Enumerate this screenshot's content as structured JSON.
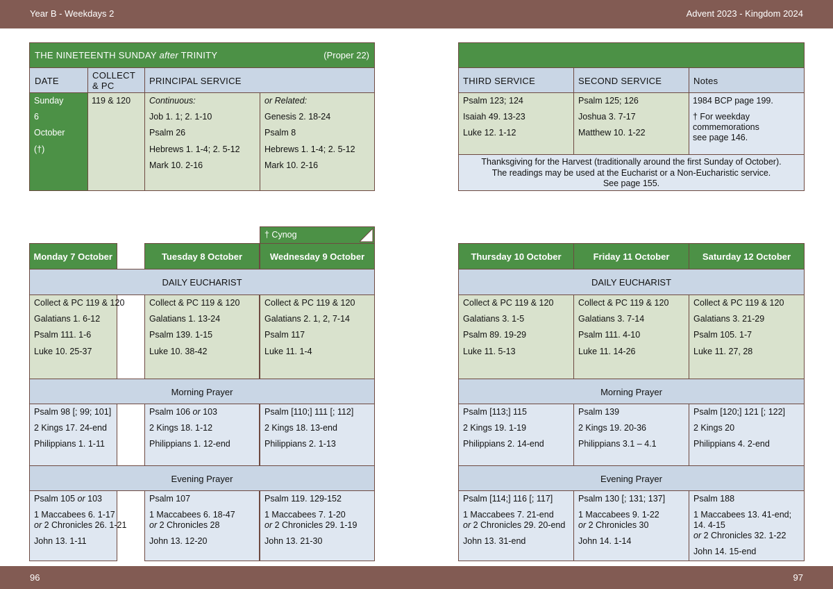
{
  "header": {
    "left": "Year B - Weekdays 2",
    "right": "Advent  2023 - Kingdom 2024"
  },
  "footer": {
    "left": "96",
    "right": "97"
  },
  "sunday": {
    "title_pre": "THE NINETEENTH SUNDAY ",
    "title_after": "after",
    "title_post": " TRINITY",
    "proper": "(Proper 22)",
    "col_date": "DATE",
    "col_collect_1": "COLLECT",
    "col_collect_2": "& PC",
    "col_principal": "PRINCIPAL SERVICE",
    "date_lines": [
      "Sunday",
      "6",
      "October",
      "(†)"
    ],
    "collect": "119 & 120",
    "continuous": [
      "Continuous:",
      "Job 1. 1;  2. 1-10",
      "Psalm 26",
      "Hebrews 1. 1-4; 2. 5-12",
      "Mark 10. 2-16"
    ],
    "related": [
      "or Related:",
      "Genesis 2. 18-24",
      "Psalm 8",
      "Hebrews 1. 1-4; 2. 5-12",
      "Mark 10. 2-16"
    ]
  },
  "right_top": {
    "col_third": "THIRD SERVICE",
    "col_second": "SECOND SERVICE",
    "col_notes": "Notes",
    "third": [
      "Psalm 123; 124",
      "Isaiah 49. 13-23",
      "Luke 12. 1-12"
    ],
    "second": [
      "Psalm 125; 126",
      "Joshua 3. 7-17",
      "Matthew 10. 1-22"
    ],
    "notes_1": "1984 BCP page 199.",
    "notes_2": [
      "† For weekday",
      "commemorations",
      "see page 146."
    ],
    "harvest": [
      "Thanksgiving for the Harvest (traditionally around the first Sunday of October).",
      "The readings may be used at the Eucharist or a Non-Eucharistic service.",
      "See page 155."
    ]
  },
  "cynog": "† Cynog",
  "sections": {
    "eucharist": "DAILY EUCHARIST",
    "morning": "Morning Prayer",
    "evening": "Evening Prayer"
  },
  "days": [
    {
      "name": "Monday 7 October",
      "eucharist": [
        "Collect & PC 119 & 120",
        "Galatians 1. 6-12",
        "Psalm 111. 1-6",
        "Luke 10. 25-37"
      ],
      "morning": [
        "Psalm 98 [; 99; 101]",
        "2 Kings 17. 24-end",
        "Philippians 1. 1-11"
      ],
      "evening": [
        {
          "t": "Psalm 105 "
        },
        {
          "i": "or"
        },
        {
          "t": " 103"
        }
      ],
      "evening_2a": "1 Maccabees 6. 1-17",
      "evening_2b": "2 Chronicles 26. 1-21",
      "evening_3": "John 13. 1-11"
    },
    {
      "name": "Tuesday 8 October",
      "eucharist": [
        "Collect & PC 119 & 120",
        "Galatians 1. 13-24",
        "Psalm 139. 1-15",
        "Luke 10. 38-42"
      ],
      "morning": [
        "2 Kings 18. 1-12",
        "Philippians 1. 12-end"
      ],
      "morning_1a": "Psalm 106 ",
      "morning_1b": "or",
      "morning_1c": " 103",
      "evening_1": "Psalm 107",
      "evening_2a": "1 Maccabees 6. 18-47",
      "evening_2b": "2 Chronicles 28",
      "evening_3": "John 13. 12-20"
    },
    {
      "name": "Wednesday 9 October",
      "eucharist": [
        "Collect & PC 119 & 120",
        "Galatians 2. 1, 2, 7-14",
        "Psalm 117",
        "Luke 11. 1-4"
      ],
      "morning": [
        "Psalm [110;] 111 [; 112]",
        "2 Kings 18. 13-end",
        "Philippians 2. 1-13"
      ],
      "evening_1": "Psalm 119. 129-152",
      "evening_2a": "1 Maccabees 7. 1-20",
      "evening_2b": "2 Chronicles 29. 1-19",
      "evening_3": "John 13. 21-30"
    },
    {
      "name": "Thursday 10 October",
      "eucharist": [
        "Collect & PC 119 & 120",
        "Galatians 3. 1-5",
        "Psalm 89. 19-29",
        "Luke 11. 5-13"
      ],
      "morning": [
        "Psalm [113;] 115",
        "2 Kings 19. 1-19",
        "Philippians 2. 14-end"
      ],
      "evening_1": "Psalm [114;] 116 [; 117]",
      "evening_2a": "1 Maccabees 7. 21-end",
      "evening_2b": "2 Chronicles 29. 20-end",
      "evening_3": "John 13. 31-end"
    },
    {
      "name": "Friday 11 October",
      "eucharist": [
        "Collect & PC 119 & 120",
        "Galatians 3. 7-14",
        "Psalm 111. 4-10",
        "Luke 11. 14-26"
      ],
      "morning": [
        "Psalm 139",
        "2 Kings 19. 20-36",
        "Philippians 3.1 – 4.1"
      ],
      "evening_1": "Psalm 130 [; 131; 137]",
      "evening_2a": "1 Maccabees 9. 1-22",
      "evening_2b": "2 Chronicles 30",
      "evening_3": "John 14. 1-14"
    },
    {
      "name": "Saturday 12 October",
      "eucharist": [
        "Collect & PC 119 & 120",
        "Galatians 3. 21-29",
        "Psalm 105. 1-7",
        "Luke 11. 27, 28"
      ],
      "morning": [
        "Psalm [120;] 121 [; 122]",
        "2 Kings 20",
        "Philippians 4. 2-end"
      ],
      "evening_1": "Psalm 188",
      "evening_2a": "1 Maccabees 13. 41-end;",
      "evening_2a2": "14. 4-15",
      "evening_2b": "2 Chronicles 32. 1-22",
      "evening_3": "John 14. 15-end"
    }
  ],
  "or_word": "or"
}
